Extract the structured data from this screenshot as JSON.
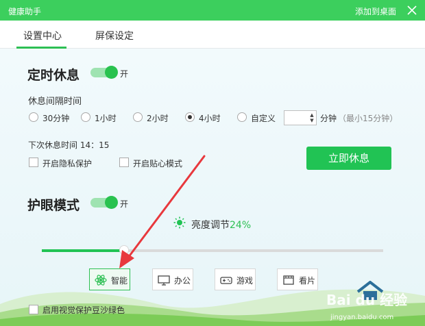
{
  "window": {
    "title": "健康助手",
    "add_desktop": "添加到桌面"
  },
  "tabs": [
    {
      "label": "设置中心"
    },
    {
      "label": "屏保设定"
    }
  ],
  "rest": {
    "title": "定时休息",
    "toggle_label": "开",
    "interval_label": "休息间隔时间",
    "options": [
      "30分钟",
      "1小时",
      "2小时",
      "4小时",
      "自定义"
    ],
    "selected": "4小时",
    "custom_value": "",
    "minutes_label": "分钟",
    "minutes_hint": "（最小15分钟）",
    "next_rest": "下次休息时间 14：15",
    "privacy_label": "开启隐私保护",
    "caring_label": "开启贴心模式",
    "rest_now_button": "立即休息"
  },
  "eye": {
    "title": "护眼模式",
    "toggle_label": "开",
    "brightness_label": "亮度调节",
    "brightness_value": "24%",
    "brightness_level": 0.24,
    "modes": [
      {
        "label": "智能",
        "icon": "atom-icon"
      },
      {
        "label": "办公",
        "icon": "monitor-icon"
      },
      {
        "label": "游戏",
        "icon": "gamepad-icon"
      },
      {
        "label": "看片",
        "icon": "film-icon"
      }
    ],
    "bean_green_label": "启用视觉保护豆沙绿色"
  },
  "watermark": {
    "logo": "Bai du 经验",
    "url": "jingyan.baidu.com"
  },
  "colors": {
    "brand_green": "#3ccf5d",
    "accent_green": "#21c354",
    "annotation_red": "#e8383d"
  }
}
